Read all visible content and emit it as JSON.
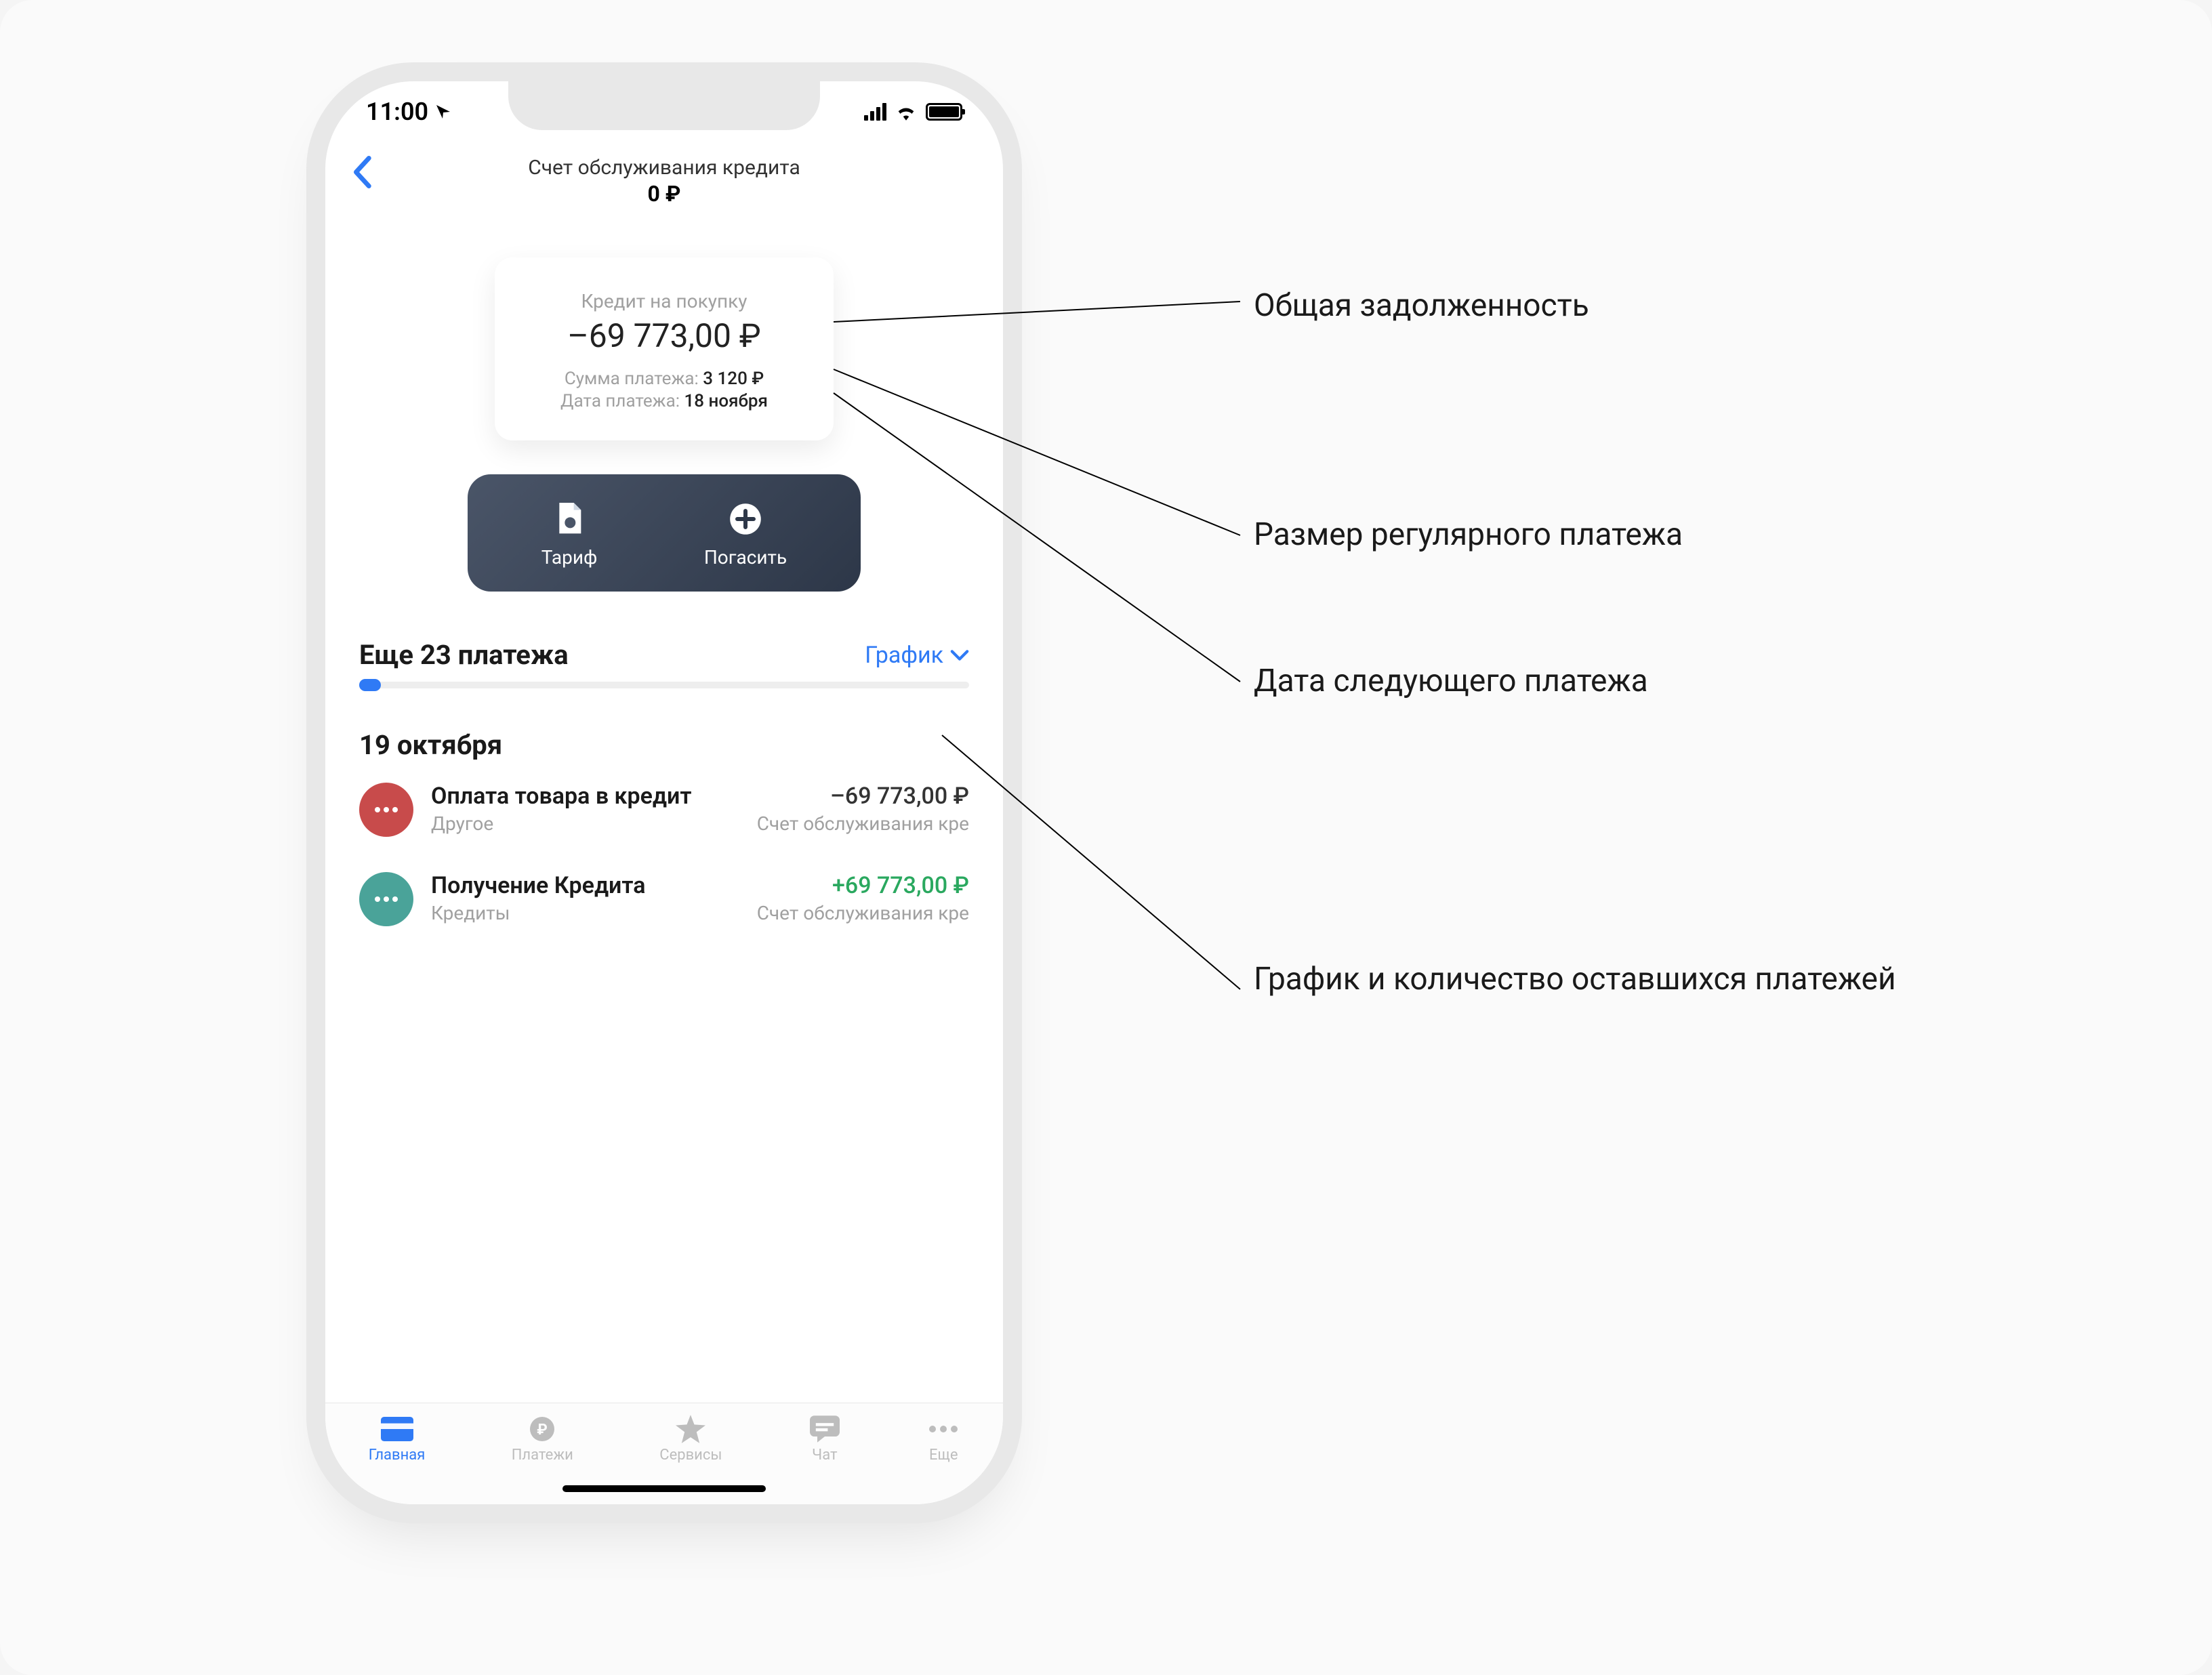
{
  "status": {
    "time": "11:00"
  },
  "nav": {
    "title": "Счет обслуживания кредита",
    "subtitle": "0 ₽"
  },
  "card": {
    "label": "Кредит на покупку",
    "amount": "–69 773,00 ₽",
    "payment_label": "Сумма платежа:",
    "payment_value": "3 120 ₽",
    "date_label": "Дата платежа:",
    "date_value": "18 ноября"
  },
  "actions": {
    "tariff_label": "Тариф",
    "repay_label": "Погасить"
  },
  "payments": {
    "title": "Еще 23 платежа",
    "schedule_link": "График"
  },
  "section_date": "19 октября",
  "transactions": [
    {
      "title": "Оплата товара в кредит",
      "amount": "–69 773,00 ₽",
      "sign": "neg",
      "category": "Другое",
      "account": "Счет обслуживания кре",
      "icon_color": "red"
    },
    {
      "title": "Получение Кредита",
      "amount": "+69 773,00 ₽",
      "sign": "pos",
      "category": "Кредиты",
      "account": "Счет обслуживания кре",
      "icon_color": "teal"
    }
  ],
  "tabs": [
    {
      "label": "Главная",
      "icon": "card",
      "active": true
    },
    {
      "label": "Платежи",
      "icon": "ruble",
      "active": false
    },
    {
      "label": "Сервисы",
      "icon": "star",
      "active": false
    },
    {
      "label": "Чат",
      "icon": "chat",
      "active": false
    },
    {
      "label": "Еще",
      "icon": "more",
      "active": false
    }
  ],
  "annotations": [
    "Общая задолженность",
    "Размер регулярного платежа",
    "Дата следующего платежа",
    "График и количество оставшихся платежей"
  ]
}
